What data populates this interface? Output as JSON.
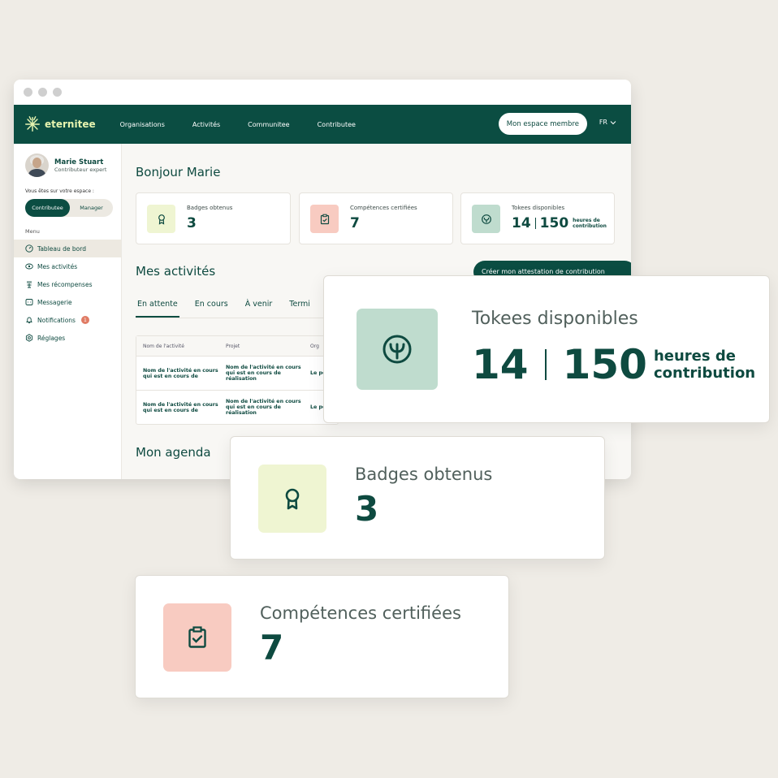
{
  "browser": {
    "dots": 3
  },
  "nav": {
    "logo_text": "eternitee",
    "items": [
      "Organisations",
      "Activités",
      "Communitee",
      "Contributee"
    ],
    "member_button": "Mon espace membre",
    "language": "FR"
  },
  "sidebar": {
    "user_name": "Marie Stuart",
    "user_role": "Contributeur expert",
    "space_label": "Vous êtes sur votre espace :",
    "switch_active": "Contributee",
    "switch_inactive": "Manager",
    "menu_label": "Menu",
    "items": [
      {
        "label": "Tableau de bord",
        "icon": "gauge-icon",
        "active": true
      },
      {
        "label": "Mes activités",
        "icon": "eye-icon"
      },
      {
        "label": "Mes récompenses",
        "icon": "trophy-icon"
      },
      {
        "label": "Messagerie",
        "icon": "message-icon"
      },
      {
        "label": "Notifications",
        "icon": "bell-icon",
        "badge": "1"
      },
      {
        "label": "Réglages",
        "icon": "settings-icon"
      }
    ]
  },
  "main": {
    "greeting": "Bonjour Marie",
    "stats": {
      "badges": {
        "label": "Badges obtenus",
        "value": "3"
      },
      "competences": {
        "label": "Compétences certifiées",
        "value": "7"
      },
      "tokees": {
        "label": "Tokees disponibles",
        "value": "14",
        "hours": "150",
        "hours_label": "heures de contribution"
      }
    },
    "activities_title": "Mes activités",
    "attestation_button": "Créer mon attestation de contribution",
    "tabs": [
      "En attente",
      "En cours",
      "À venir",
      "Termi"
    ],
    "table": {
      "headers": [
        "Nom de l'activité",
        "Projet",
        "Org"
      ],
      "rows": [
        [
          "Nom de l'activité en cours qui est en cours de",
          "Nom de l'activité en cours qui est en cours de réalisation",
          "Le po"
        ],
        [
          "Nom de l'activité en cours qui est en cours de",
          "Nom de l'activité en cours qui est en cours de réalisation",
          "Le po"
        ]
      ]
    },
    "agenda_title": "Mon agenda"
  },
  "floating": {
    "tokees": {
      "label": "Tokees disponibles",
      "value": "14",
      "hours": "150",
      "hours_line1": "heures de",
      "hours_line2": "contribution"
    },
    "badges": {
      "label": "Badges obtenus",
      "value": "3"
    },
    "competences": {
      "label": "Compétences certifiées",
      "value": "7"
    }
  },
  "colors": {
    "brand": "#0b4d42",
    "background": "#efece6",
    "badge_bg": "#eff5d2",
    "competence_bg": "#f8cbc1",
    "tokee_bg": "#bfdcce",
    "notification": "#e07b64"
  }
}
